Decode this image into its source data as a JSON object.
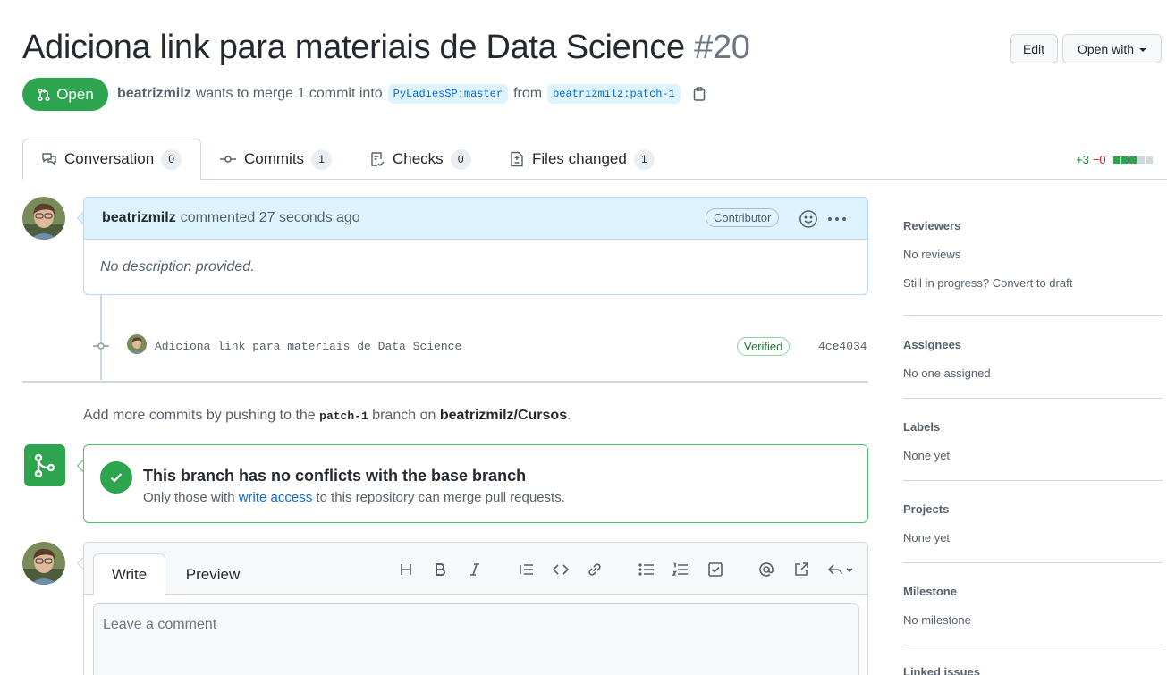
{
  "header": {
    "title": "Adiciona link para materiais de Data Science",
    "number": "#20",
    "edit_label": "Edit",
    "open_with_label": "Open with"
  },
  "state": {
    "label": "Open",
    "color": "#2da44e"
  },
  "meta": {
    "author": "beatrizmilz",
    "text_wants": "wants to merge 1 commit into",
    "base_branch": "PyLadiesSP:master",
    "text_from": "from",
    "head_branch": "beatrizmilz:patch-1"
  },
  "tabs": [
    {
      "label": "Conversation",
      "count": "0"
    },
    {
      "label": "Commits",
      "count": "1"
    },
    {
      "label": "Checks",
      "count": "0"
    },
    {
      "label": "Files changed",
      "count": "1"
    }
  ],
  "diffstat": {
    "additions": "+3",
    "deletions": "−0"
  },
  "comment": {
    "author": "beatrizmilz",
    "action": "commented 27 seconds ago",
    "role": "Contributor",
    "body": "No description provided."
  },
  "commit": {
    "message": "Adiciona link para materiais de Data Science",
    "verified_label": "Verified",
    "sha": "4ce4034"
  },
  "push_hint": {
    "prefix": "Add more commits by pushing to the",
    "branch": "patch-1",
    "middle": "branch on",
    "repo": "beatrizmilz/Cursos",
    "suffix": "."
  },
  "merge": {
    "title": "This branch has no conflicts with the base branch",
    "sub_prefix": "Only those with",
    "sub_link": "write access",
    "sub_suffix": "to this repository can merge pull requests."
  },
  "editor": {
    "write_tab": "Write",
    "preview_tab": "Preview",
    "placeholder": "Leave a comment",
    "tools": [
      "heading-icon",
      "bold-icon",
      "italic-icon",
      "quote-icon",
      "code-icon",
      "link-icon",
      "bullet-list-icon",
      "numbered-list-icon",
      "task-list-icon",
      "mention-icon",
      "cross-reference-icon",
      "saved-reply-icon"
    ]
  },
  "sidebar": {
    "reviewers": {
      "title": "Reviewers",
      "value": "No reviews",
      "extra": "Still in progress? Convert to draft"
    },
    "assignees": {
      "title": "Assignees",
      "value": "No one assigned"
    },
    "labels": {
      "title": "Labels",
      "value": "None yet"
    },
    "projects": {
      "title": "Projects",
      "value": "None yet"
    },
    "milestone": {
      "title": "Milestone",
      "value": "No milestone"
    },
    "linked_issues": {
      "title": "Linked issues"
    }
  }
}
